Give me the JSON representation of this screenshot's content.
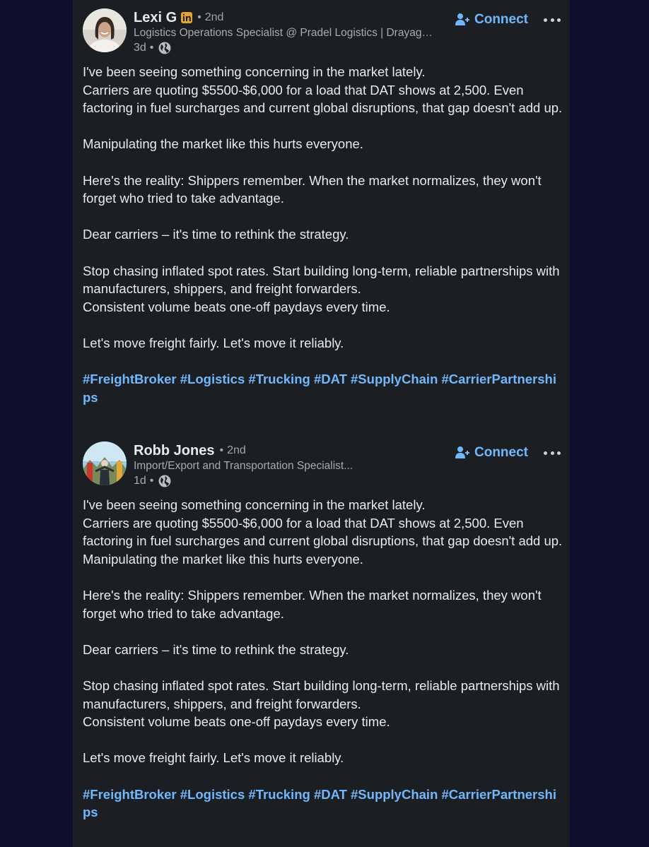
{
  "posts": [
    {
      "author": {
        "name": "Lexi G",
        "has_premium_badge": true,
        "degree": "2nd",
        "headline": "Logistics Operations Specialist @ Pradel Logistics | Drayag…",
        "time": "3d"
      },
      "connect_label": "Connect",
      "body": [
        [
          "I've been seeing something concerning in the market lately.",
          "Carriers are quoting $5500-$6,000 for a load that DAT shows at 2,500. Even factoring in fuel surcharges and current global disruptions, that gap doesn't add up."
        ],
        [
          "Manipulating the market like this hurts everyone."
        ],
        [
          "Here's the reality: Shippers remember. When the market normalizes, they won't forget who tried to take advantage."
        ],
        [
          "Dear carriers – it's time to rethink the strategy."
        ],
        [
          "Stop chasing inflated spot rates. Start building long-term, reliable partnerships with manufacturers, shippers, and freight forwarders.",
          "Consistent volume beats one-off paydays every time."
        ],
        [
          "Let's move freight fairly. Let's move it reliably."
        ]
      ],
      "hashtags": [
        "#FreightBroker",
        "#Logistics",
        "#Trucking",
        "#DAT",
        "#SupplyChain",
        "#CarrierPartnerships"
      ]
    },
    {
      "author": {
        "name": "Robb Jones",
        "has_premium_badge": false,
        "degree": "2nd",
        "headline": "Import/Export and Transportation Specialist...",
        "time": "1d"
      },
      "connect_label": "Connect",
      "body": [
        [
          "I've been seeing something concerning in the market lately.",
          "Carriers are quoting $5500-$6,000 for a load that DAT shows at 2,500. Even factoring in fuel surcharges and current global disruptions, that gap doesn't add up.",
          "Manipulating the market like this hurts everyone."
        ],
        [
          "Here's the reality: Shippers remember. When the market normalizes, they won't forget who tried to take advantage."
        ],
        [
          "Dear carriers – it's time to rethink the strategy."
        ],
        [
          "Stop chasing inflated spot rates. Start building long-term, reliable partnerships with manufacturers, shippers, and freight forwarders.",
          "Consistent volume beats one-off paydays every time."
        ],
        [
          "Let's move freight fairly. Let's move it reliably."
        ]
      ],
      "hashtags": [
        "#FreightBroker",
        "#Logistics",
        "#Trucking",
        "#DAT",
        "#SupplyChain",
        "#CarrierPartnerships"
      ]
    }
  ],
  "icons": {
    "premium": "linkedin-premium-icon",
    "visibility": "globe-icon",
    "connect": "add-person-icon",
    "more": "more-icon"
  },
  "colors": {
    "background": "#0e0f2b",
    "card": "#1b1f23",
    "text": "#eaeaea",
    "secondary_text": "#a7aaaf",
    "link": "#71b7fb",
    "premium_badge": "#e3a52f"
  }
}
